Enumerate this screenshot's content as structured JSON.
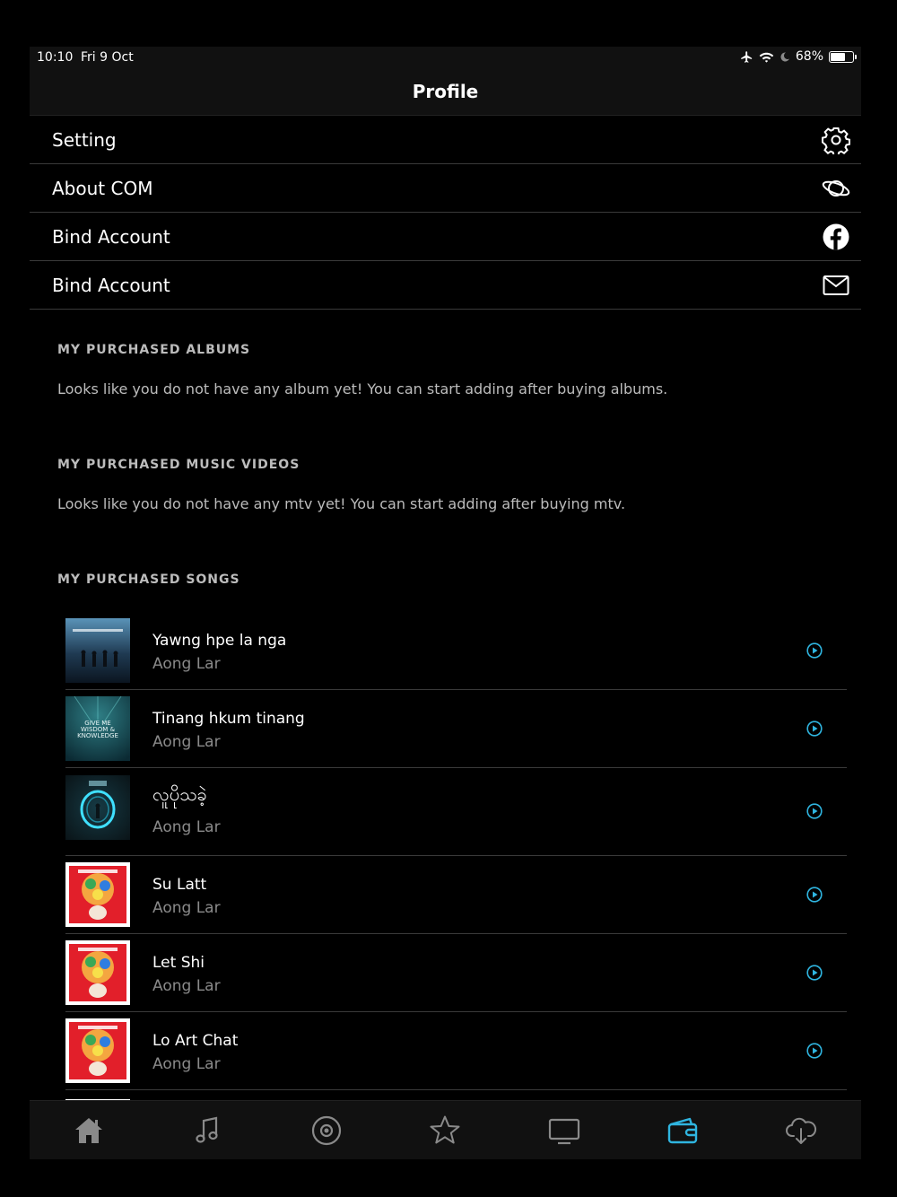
{
  "status": {
    "time": "10:10",
    "date": "Fri 9 Oct",
    "battery_percent": "68%",
    "battery_level": 0.68,
    "icons": [
      "airplane-icon",
      "wifi-icon",
      "moon-icon",
      "battery-icon"
    ]
  },
  "header": {
    "title": "Profile"
  },
  "menu": {
    "items": [
      {
        "label": "Setting",
        "icon": "gear-icon"
      },
      {
        "label": "About COM",
        "icon": "planet-icon"
      },
      {
        "label": "Bind Account",
        "icon": "facebook-icon"
      },
      {
        "label": "Bind Account",
        "icon": "mail-icon"
      }
    ]
  },
  "albums": {
    "title": "MY PURCHASED ALBUMS",
    "empty_text": "Looks like you do not have any album yet! You can start adding after buying albums."
  },
  "videos": {
    "title": "MY PURCHASED MUSIC VIDEOS",
    "empty_text": "Looks like you do not have any mtv yet! You can start adding after buying mtv."
  },
  "songs": {
    "title": "MY PURCHASED SONGS",
    "items": [
      {
        "name": "Yawng hpe la nga",
        "artist": "Aong Lar",
        "art_text": ""
      },
      {
        "name": "Tinang hkum tinang",
        "artist": "Aong Lar",
        "art_text": "GIVE ME WISDOM & KNOWLEDGE"
      },
      {
        "name": "လူပိုသခဲ့",
        "artist": "Aong Lar",
        "art_text": ""
      },
      {
        "name": "Su Latt",
        "artist": "Aong Lar",
        "art_text": ""
      },
      {
        "name": "Let Shi",
        "artist": "Aong Lar",
        "art_text": ""
      },
      {
        "name": "Lo Art Chat",
        "artist": "Aong Lar",
        "art_text": ""
      }
    ]
  },
  "tabbar": {
    "tabs": [
      {
        "icon": "home-icon"
      },
      {
        "icon": "music-note-icon"
      },
      {
        "icon": "disc-icon"
      },
      {
        "icon": "star-icon"
      },
      {
        "icon": "tv-icon"
      },
      {
        "icon": "wallet-icon",
        "active": true
      },
      {
        "icon": "cloud-download-icon"
      }
    ],
    "accent": "#2fb5e0",
    "inactive": "#8a8a8a"
  }
}
